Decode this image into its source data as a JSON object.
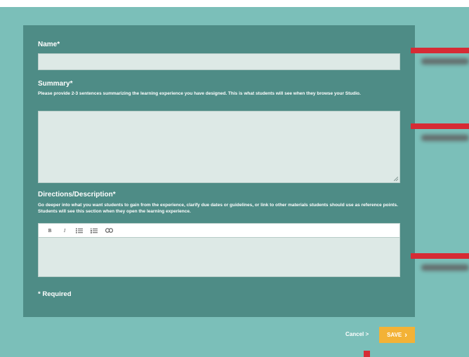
{
  "form": {
    "name_label": "Name*",
    "summary_label": "Summary*",
    "summary_help": "Please provide 2-3 sentences summarizing the learning experience you have designed. This is what students will see when they browse your Studio.",
    "directions_label": "Directions/Description*",
    "directions_help": "Go deeper into what you want students to gain from the experience, clarify due dates or guidelines, or link to other materials students should use as reference points. Students will see this section when they open the learning experience.",
    "required_note": "* Required",
    "name_value": "",
    "summary_value": ""
  },
  "toolbar": {
    "bold": "B",
    "italic": "I"
  },
  "footer": {
    "cancel_label": "Cancel >",
    "save_label": "SAVE",
    "save_chevron": "›"
  },
  "colors": {
    "background": "#7bbfb9",
    "panel": "#4e8c86",
    "field": "#dde9e6",
    "save_button": "#f3b236",
    "marker": "#d62b35"
  }
}
